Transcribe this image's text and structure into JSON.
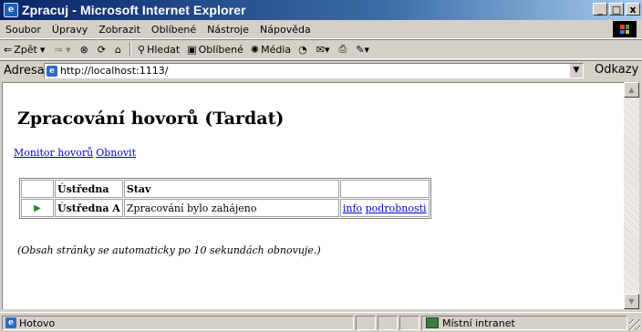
{
  "window": {
    "title": "Zpracuj - Microsoft Internet Explorer",
    "controls": {
      "minimize": "_",
      "maximize": "□",
      "close": "x"
    }
  },
  "menu": {
    "items": [
      "Soubor",
      "Úpravy",
      "Zobrazit",
      "Oblíbené",
      "Nástroje",
      "Nápověda"
    ]
  },
  "toolbar": {
    "back": "Zpět",
    "search": "Hledat",
    "favorites": "Oblíbené",
    "media": "Média"
  },
  "address": {
    "label": "Adresa",
    "url": "http://localhost:1113/",
    "links_label": "Odkazy"
  },
  "page": {
    "title": "Zpracování hovorů (Tardat)",
    "links": [
      "Monitor hovorů",
      "Obnovit"
    ],
    "table": {
      "headers": [
        "",
        "Ústředna",
        "Stav",
        ""
      ],
      "rows": [
        {
          "icon": "play-arrow-icon",
          "ustredna": "Ústředna A",
          "stav": "Zpracování bylo zahájeno",
          "link_info": "info",
          "link_details": "podrobnosti"
        }
      ]
    },
    "note": "(Obsah stránky se automaticky po 10 sekundách obnovuje.)"
  },
  "status": {
    "text": "Hotovo",
    "zone": "Místní intranet"
  },
  "colors": {
    "title_bar": "#0a246a",
    "link": "#0000cc",
    "arrow": "#1b8b1b",
    "chrome": "#d4d0c8"
  }
}
